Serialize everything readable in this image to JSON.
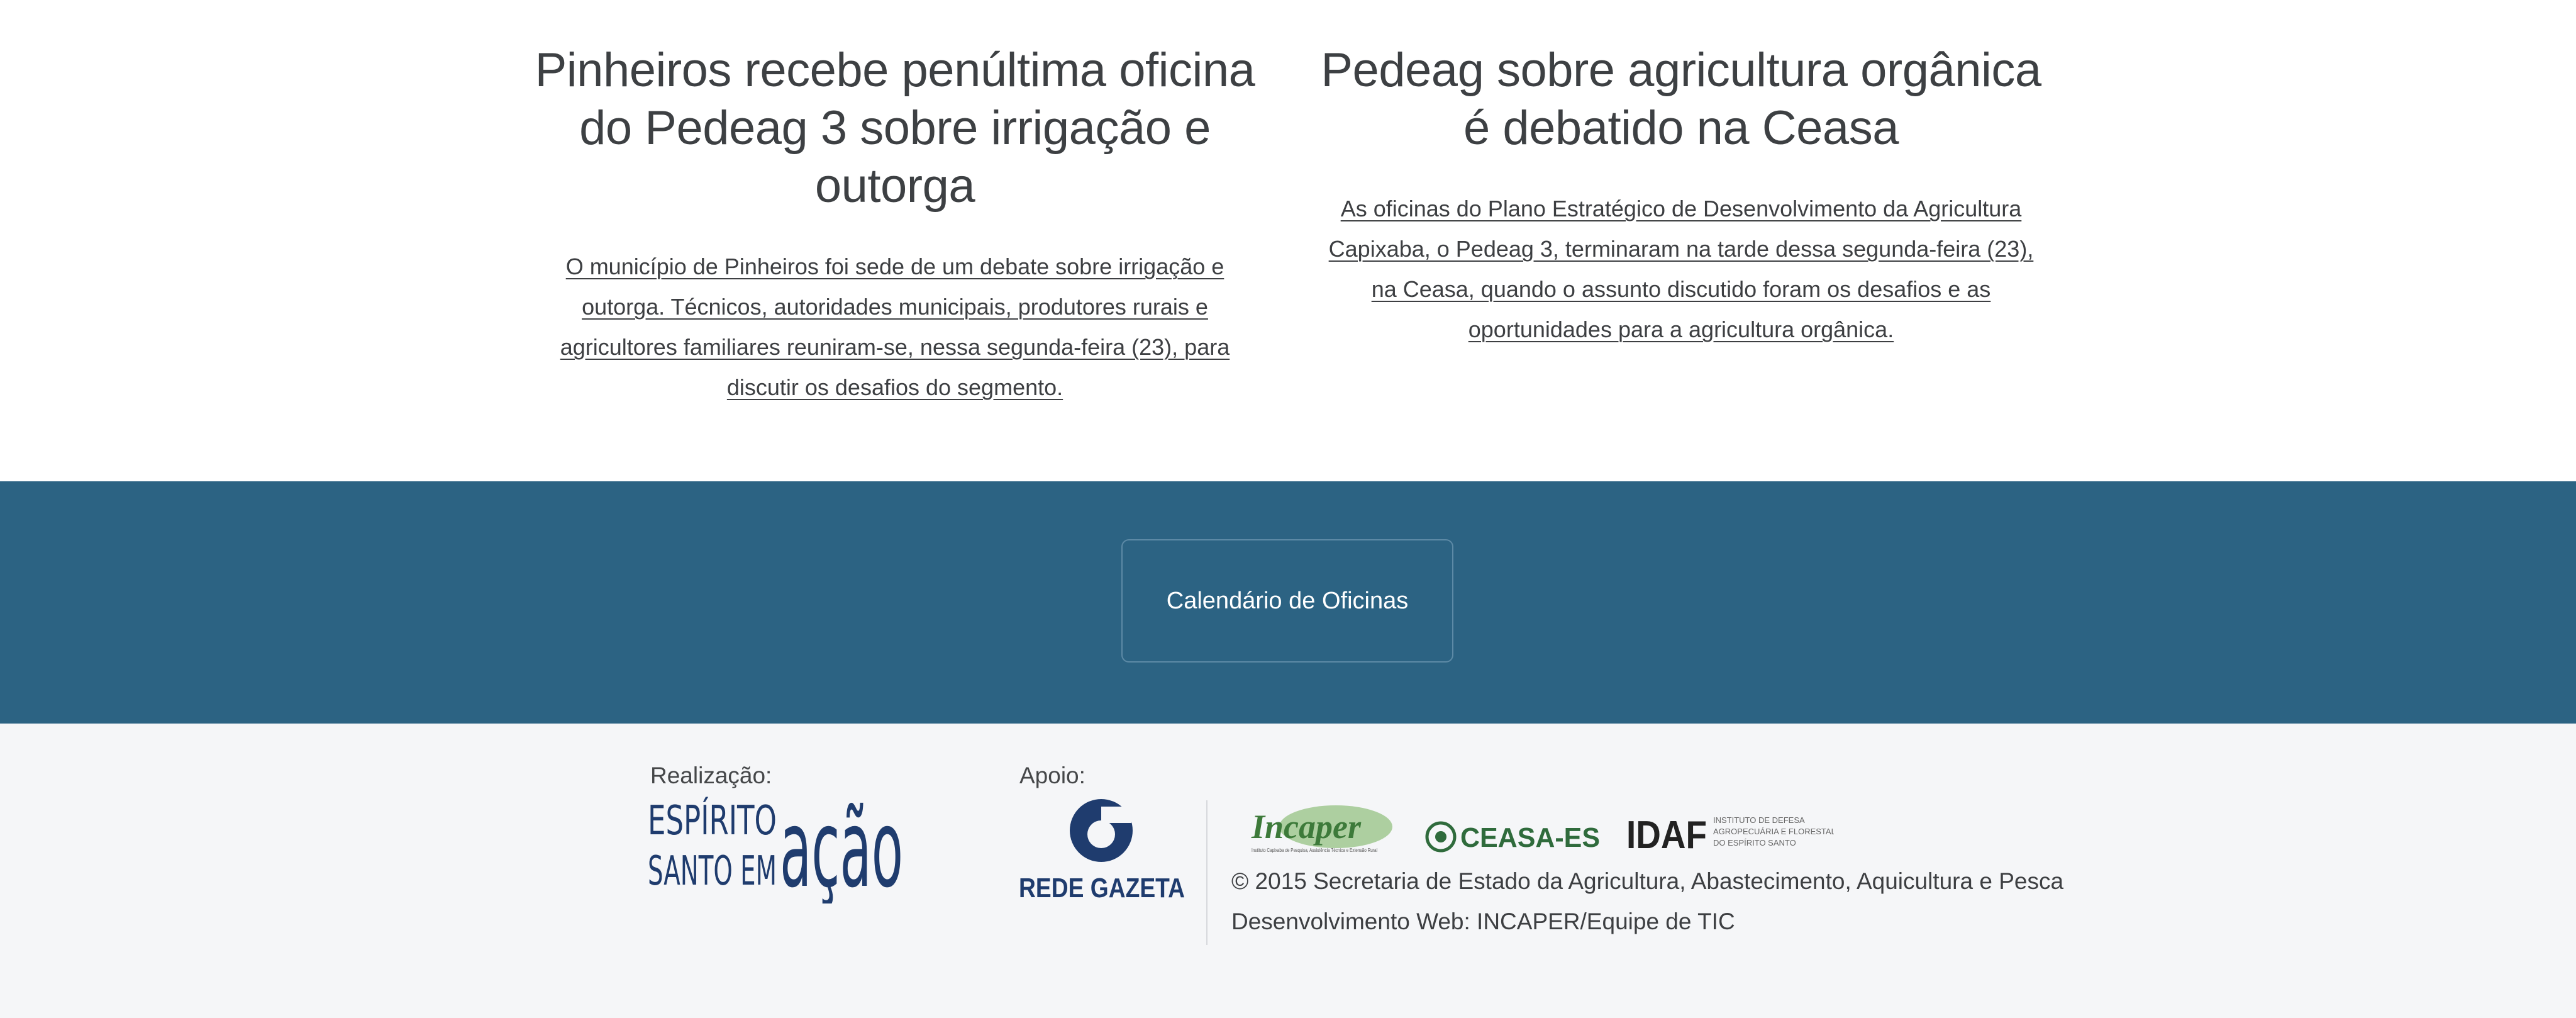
{
  "articles": [
    {
      "title": "Pinheiros recebe penúltima oficina do Pedeag 3 sobre irrigação e outorga",
      "summary": "O município de Pinheiros foi sede de um debate sobre irrigação e outorga. Técnicos, autoridades municipais, produtores rurais e agricultores familiares reuniram-se, nessa segunda-feira (23), para discutir os desafios do segmento."
    },
    {
      "title": "Pedeag sobre agricultura orgânica é debatido na Ceasa",
      "summary": "As oficinas do Plano Estratégico de Desenvolvimento da Agricultura Capixaba, o Pedeag 3, terminaram na tarde dessa segunda-feira (23), na Ceasa, quando o assunto discutido foram os desafios e as oportunidades para a agricultura orgânica."
    }
  ],
  "cta": {
    "calendar_label": "Calendário de Oficinas"
  },
  "footer": {
    "realizacao_label": "Realização:",
    "apoio_label": "Apoio:",
    "logos": {
      "espirito_santo": {
        "line1": "ESPÍRITO",
        "line2": "SANTO EM",
        "big": "ação"
      },
      "rede_gazeta": {
        "text": "REDE GAZETA"
      },
      "incaper": {
        "text": "Incaper",
        "sub": "Instituto Capixaba de Pesquisa, Assistência Técnica e Extensão Rural"
      },
      "ceasa": {
        "text": "CEASA-ES"
      },
      "idaf": {
        "text": "IDAF",
        "sub1": "INSTITUTO DE DEFESA",
        "sub2": "AGROPECUÁRIA E FLORESTAL",
        "sub3": "DO ESPÍRITO SANTO"
      }
    },
    "copyright": "© 2015 Secretaria de Estado da Agricultura, Abastecimento, Aquicultura e Pesca",
    "developer": "Desenvolvimento Web: INCAPER/Equipe de TIC"
  },
  "colors": {
    "band": "#2c6383",
    "footer_bg": "#f5f6f8",
    "logo_navy": "#1f3c6e",
    "incaper_green": "#3d7a3a",
    "ceasa_green": "#2f6b3c",
    "text": "#3d3f42"
  }
}
